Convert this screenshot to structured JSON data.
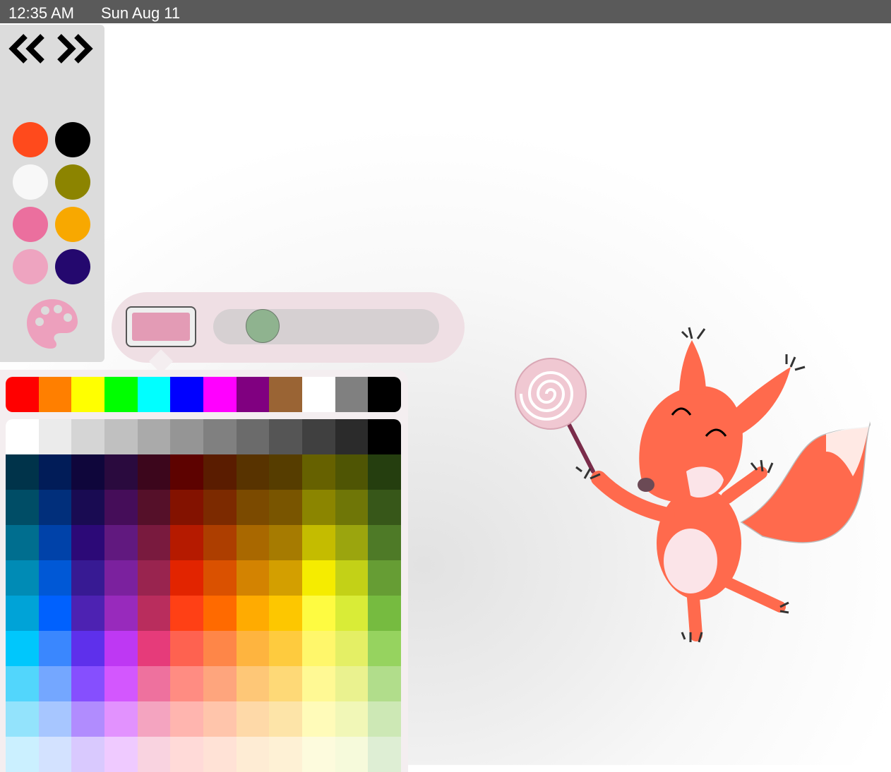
{
  "status_bar": {
    "time": "12:35 AM",
    "date": "Sun Aug 11"
  },
  "toolbar": {
    "undo_icon": "double-chevron-left-icon",
    "redo_icon": "double-chevron-right-icon",
    "swatches": [
      "#ff4a1c",
      "#000000",
      "#f8f8f8",
      "#8c8400",
      "#eb6f9e",
      "#f8a800",
      "#eea4c0",
      "#24086e"
    ],
    "palette_icon": "palette-icon",
    "palette_color": "#eda0bd"
  },
  "brush": {
    "current_color": "#e39bb5",
    "slider_color": "#8fb38f",
    "size_level": 0.17
  },
  "picker": {
    "top_row": [
      "#ff0000",
      "#ff7f00",
      "#ffff00",
      "#00ff00",
      "#00ffff",
      "#0000ff",
      "#ff00ff",
      "#800080",
      "#9a6434",
      "#ffffff",
      "#808080",
      "#000000"
    ],
    "grid": [
      [
        "#ffffff",
        "#ebebeb",
        "#d5d5d5",
        "#c0c0c0",
        "#aaaaaa",
        "#959595",
        "#808080",
        "#6b6b6b",
        "#555555",
        "#404040",
        "#2b2b2b",
        "#000000"
      ],
      [
        "#00334a",
        "#011c58",
        "#0f063b",
        "#2a0a3e",
        "#3c061c",
        "#5d0200",
        "#5a1c00",
        "#583300",
        "#563d00",
        "#666100",
        "#4f5504",
        "#253e0f"
      ],
      [
        "#004d66",
        "#012f7b",
        "#190b52",
        "#450d59",
        "#551029",
        "#831200",
        "#7c2a00",
        "#7b4a00",
        "#795500",
        "#8b8500",
        "#6f7607",
        "#375719"
      ],
      [
        "#006e8f",
        "#0042a9",
        "#2c0977",
        "#61197f",
        "#791a3e",
        "#b51a00",
        "#ad3e00",
        "#a96800",
        "#a67b01",
        "#c4bc00",
        "#9ba50e",
        "#4e7a27"
      ],
      [
        "#008bb5",
        "#0058d6",
        "#371a93",
        "#7b219e",
        "#99244f",
        "#e22400",
        "#da5100",
        "#d38301",
        "#d39f00",
        "#f5ec00",
        "#c3d117",
        "#669d34"
      ],
      [
        "#00a3d7",
        "#0061fe",
        "#4d22b2",
        "#982abc",
        "#b92d5d",
        "#ff4015",
        "#ff6a00",
        "#ffab01",
        "#fdc700",
        "#fefb41",
        "#d9ec37",
        "#76bb40"
      ],
      [
        "#00c7fc",
        "#3a87fe",
        "#5e30eb",
        "#be38f3",
        "#e63b7a",
        "#fe6250",
        "#fe8648",
        "#feb43f",
        "#fecb3e",
        "#fff76b",
        "#e4ef65",
        "#96d35f"
      ],
      [
        "#52d6fc",
        "#74a7ff",
        "#864ffe",
        "#d357fe",
        "#ee719e",
        "#ff8c82",
        "#fea57d",
        "#fec777",
        "#fed977",
        "#fff994",
        "#eaf28f",
        "#b1dd8b"
      ],
      [
        "#93e3fc",
        "#a7c6ff",
        "#b18cfe",
        "#e292fe",
        "#f4a4c0",
        "#ffb5af",
        "#ffc5ab",
        "#fed9a8",
        "#fde4a8",
        "#fffbb9",
        "#f1f7b7",
        "#cde8b5"
      ],
      [
        "#cbf0ff",
        "#d3e2ff",
        "#d9c9fe",
        "#efcaff",
        "#f9d3e0",
        "#ffdad8",
        "#ffe2d6",
        "#feecd4",
        "#fef1d5",
        "#fdfbdd",
        "#f6fadb",
        "#deeed4"
      ]
    ]
  },
  "canvas": {
    "drawing": "squirrel-with-lollipop",
    "body_color": "#ff6a4d",
    "lollipop_color": "#f0c8d2"
  }
}
